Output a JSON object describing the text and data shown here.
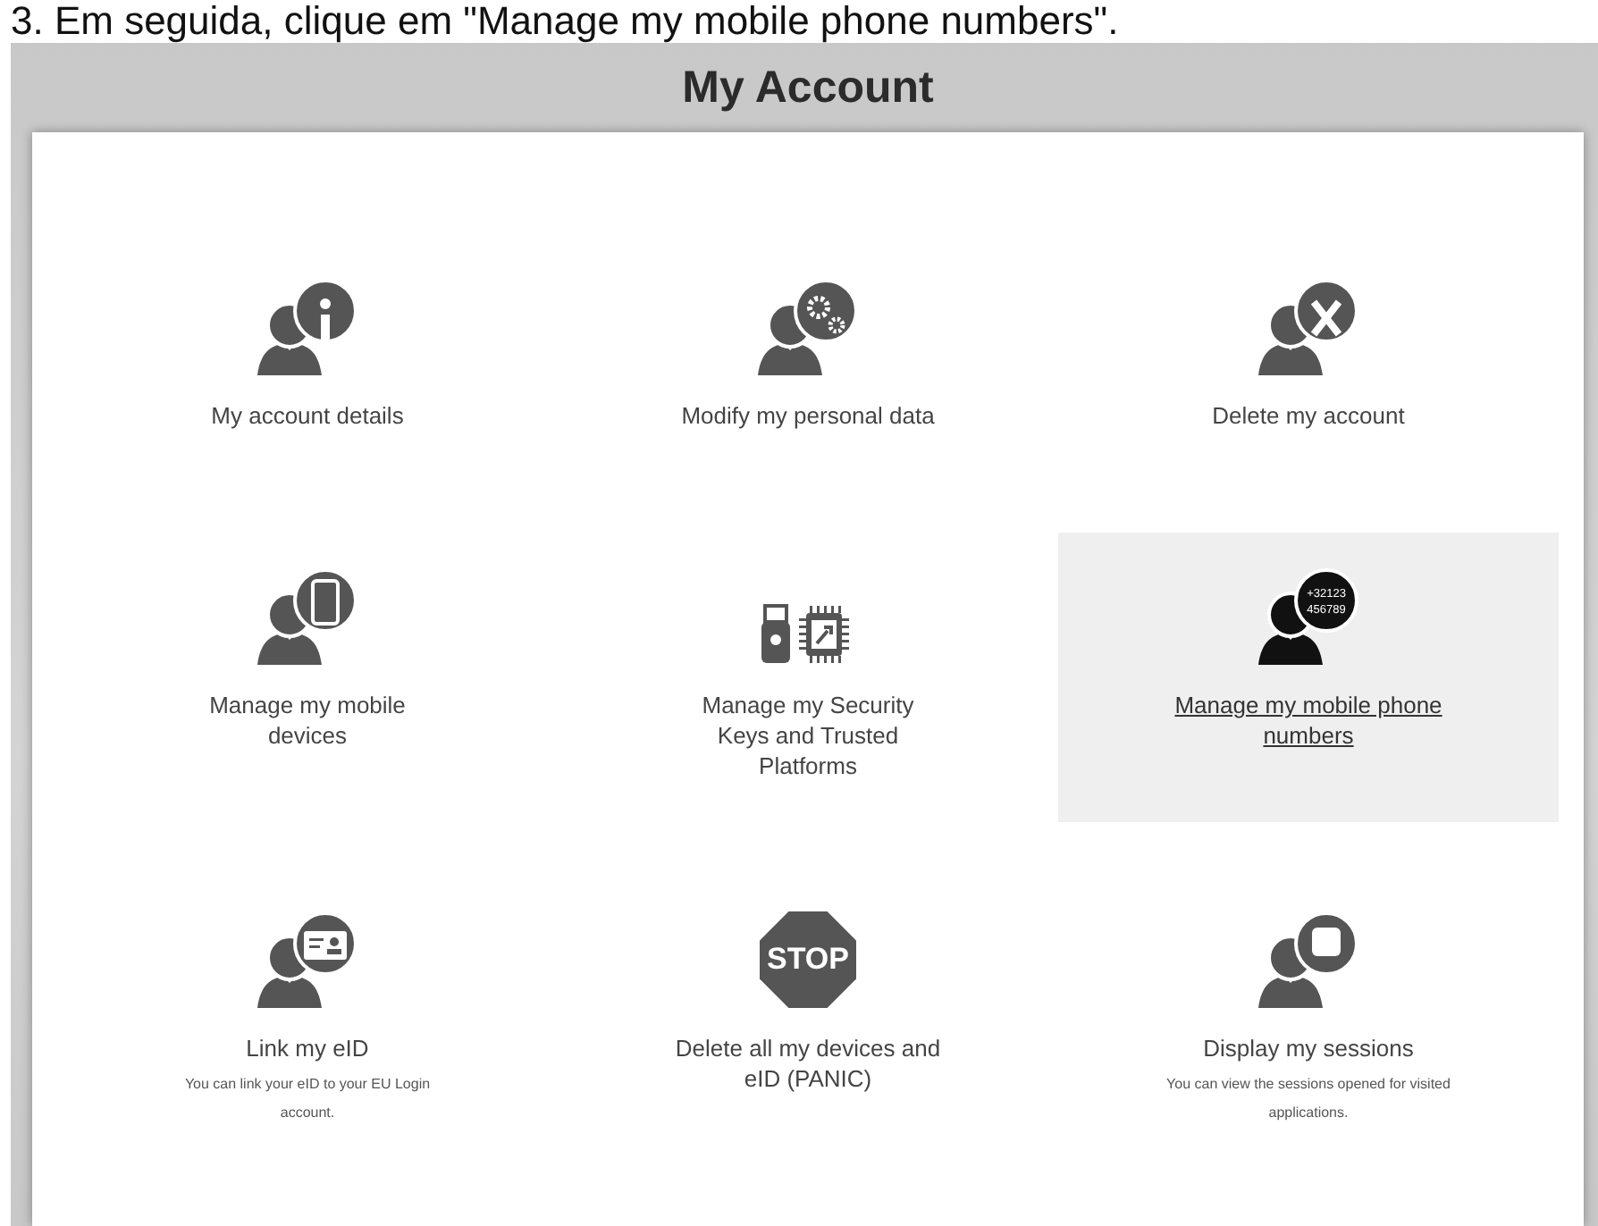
{
  "caption": "3. Em seguida, clique em \"Manage my mobile phone numbers\".",
  "header": {
    "title": "My Account"
  },
  "tiles": [
    {
      "kind": "info",
      "label": "My account details",
      "selected": false
    },
    {
      "kind": "gears",
      "label": "Modify my personal data",
      "selected": false
    },
    {
      "kind": "cross",
      "label": "Delete my account",
      "selected": false
    },
    {
      "kind": "phone",
      "label": "Manage my mobile devices",
      "selected": false
    },
    {
      "kind": "keys",
      "label": "Manage my Security Keys and Trusted Platforms",
      "selected": false
    },
    {
      "kind": "numbers",
      "label": "Manage my mobile phone numbers",
      "selected": true,
      "badge_lines": [
        "+32123",
        "456789"
      ]
    },
    {
      "kind": "card",
      "label": "Link my eID",
      "selected": false,
      "description": "You can link your eID to your EU Login account."
    },
    {
      "kind": "stop",
      "label": "Delete all my devices and eID (PANIC)",
      "selected": false,
      "badge_lines": [
        "STOP"
      ]
    },
    {
      "kind": "session",
      "label": "Display my sessions",
      "selected": false,
      "description": "You can view the sessions opened for visited applications."
    }
  ]
}
